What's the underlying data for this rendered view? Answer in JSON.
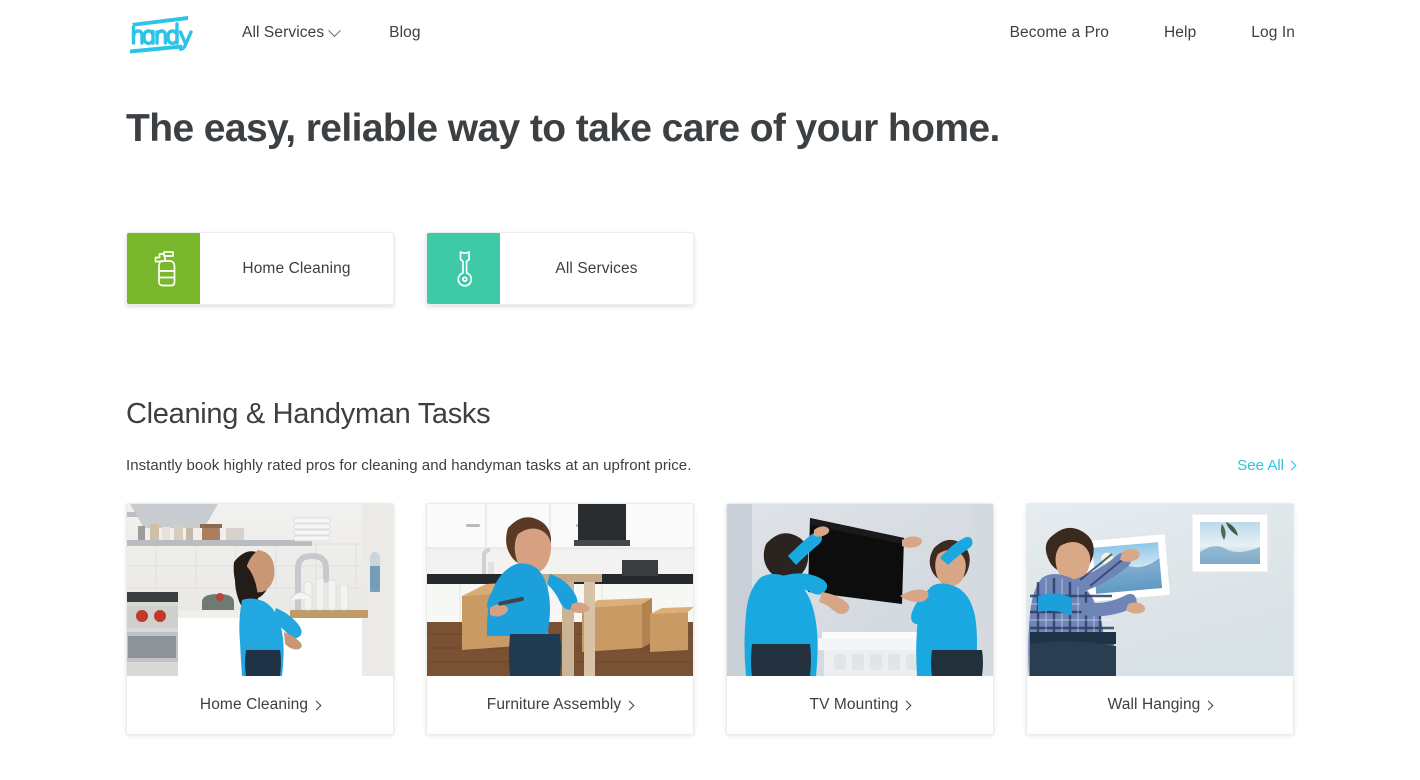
{
  "brand": {
    "logo_text": "handy",
    "logo_color": "#2bc4e8"
  },
  "header": {
    "nav_left": [
      {
        "label": "All Services",
        "icon": "chevron-down-icon",
        "has_chevron": true
      },
      {
        "label": "Blog",
        "has_chevron": false
      }
    ],
    "nav_right": [
      {
        "label": "Become a Pro"
      },
      {
        "label": "Help"
      },
      {
        "label": "Log In"
      }
    ]
  },
  "hero": {
    "title": "The easy, reliable way to take care of your home."
  },
  "picker": {
    "cards": [
      {
        "label": "Home Cleaning",
        "icon": "spray-bottle-icon",
        "color": "#79b72c",
        "theme": "green"
      },
      {
        "label": "All Services",
        "icon": "wrench-icon",
        "color": "#3ec9a7",
        "theme": "teal"
      }
    ]
  },
  "section": {
    "title": "Cleaning & Handyman Tasks",
    "subtitle": "Instantly book highly rated pros for cleaning and handyman tasks at an upfront price.",
    "see_all_label": "See All",
    "see_all_color": "#2ec4dd"
  },
  "tasks": {
    "cards": [
      {
        "label": "Home Cleaning",
        "photo": "woman in blue polo washing dishes at kitchen sink"
      },
      {
        "label": "Furniture Assembly",
        "photo": "man in blue t-shirt assembling furniture beside cardboard boxes"
      },
      {
        "label": "TV Mounting",
        "photo": "two men in blue polos lifting a flat screen tv onto a wall"
      },
      {
        "label": "Wall Hanging",
        "photo": "man in plaid shirt hanging framed pictures on a wall"
      }
    ]
  }
}
